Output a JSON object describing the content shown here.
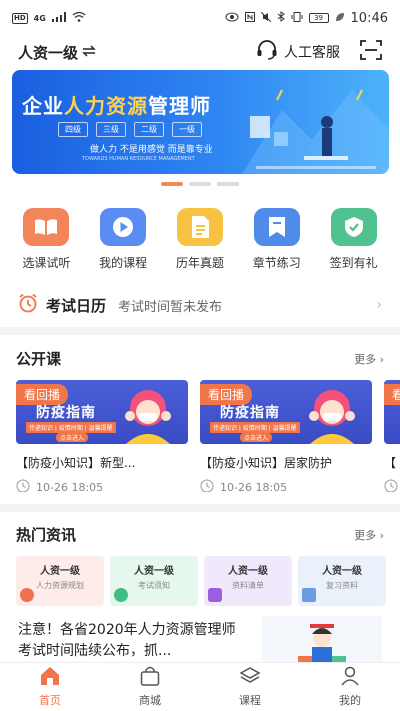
{
  "status_bar": {
    "network": "HD",
    "signal": "4G",
    "battery": "39",
    "time": "10:46"
  },
  "header": {
    "level_label": "人资一级",
    "switch_icon": "swap-icon",
    "service_label": "人工客服",
    "scan_icon": "scan-icon"
  },
  "banner": {
    "title_a": "企业",
    "title_b": "人力资源",
    "title_c": "管理师",
    "levels": [
      "四级",
      "三级",
      "二级",
      "一级"
    ],
    "slogan": "做人力 不是用感觉 而是靠专业",
    "sub": "TOWARDS HUMAN RESOURCE MANAGEMENT",
    "dots": 3,
    "active_dot": 0
  },
  "quick_actions": [
    {
      "label": "选课试听",
      "icon": "book-icon",
      "color": "#f2855a"
    },
    {
      "label": "我的课程",
      "icon": "play-icon",
      "color": "#5a8cf2"
    },
    {
      "label": "历年真题",
      "icon": "document-icon",
      "color": "#f7c242"
    },
    {
      "label": "章节练习",
      "icon": "bookmark-icon",
      "color": "#4f8be8"
    },
    {
      "label": "签到有礼",
      "icon": "check-shield-icon",
      "color": "#4fc28f"
    }
  ],
  "calendar": {
    "title": "考试日历",
    "text": "考试时间暂未发布"
  },
  "open_course": {
    "title": "公开课",
    "more": "更多",
    "items": [
      {
        "tag": "看回播",
        "thumb_title": "防疫指南",
        "thumb_sub": "传递知识 | 疫情时期 | 温馨提醒",
        "thumb_btn": "点击进入",
        "name": "【防疫小知识】新型...",
        "time": "10-26 18:05"
      },
      {
        "tag": "看回播",
        "thumb_title": "防疫指南",
        "thumb_sub": "传递知识 | 疫情时期 | 温馨提醒",
        "thumb_btn": "点击进入",
        "name": "【防疫小知识】居家防护",
        "time": "10-26 18:05"
      },
      {
        "tag": "看",
        "thumb_title": "",
        "thumb_sub": "",
        "thumb_btn": "",
        "name": "【",
        "time": ""
      }
    ]
  },
  "news": {
    "title": "热门资讯",
    "more": "更多",
    "cards": [
      {
        "title": "人资一级",
        "sub": "人力资源规划",
        "bg": "#fdecea",
        "icon_color": "#f07050"
      },
      {
        "title": "人资一级",
        "sub": "考试须知",
        "bg": "#e6f7ee",
        "icon_color": "#3fbf7f"
      },
      {
        "title": "人资一级",
        "sub": "资料清单",
        "bg": "#f1e9fb",
        "icon_color": "#9a5fe0"
      },
      {
        "title": "人资一级",
        "sub": "复习资料",
        "bg": "#eaf1fb",
        "icon_color": "#6b9be0"
      }
    ],
    "headline": "注意！各省2020年人力资源管理师考试时间陆续公布，抓..."
  },
  "tabbar": [
    {
      "label": "首页",
      "icon": "home-icon",
      "active": true
    },
    {
      "label": "商城",
      "icon": "shop-bag-icon",
      "active": false
    },
    {
      "label": "课程",
      "icon": "layers-icon",
      "active": false
    },
    {
      "label": "我的",
      "icon": "user-icon",
      "active": false
    }
  ],
  "colors": {
    "accent": "#f0764a",
    "banner": "#2f86f2"
  }
}
